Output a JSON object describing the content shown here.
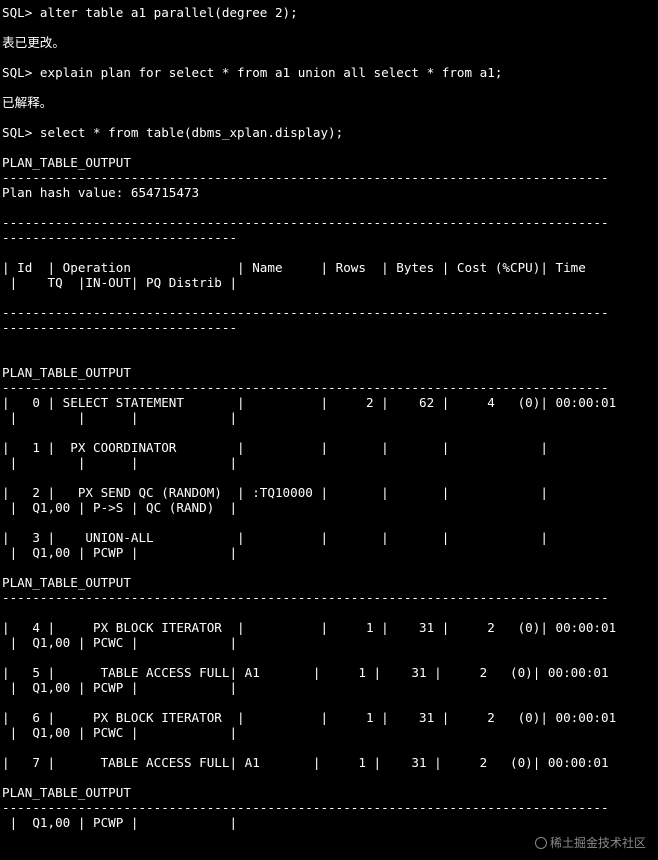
{
  "terminal": {
    "lines": [
      "SQL> alter table a1 parallel(degree 2);",
      "",
      "表已更改。",
      "",
      "SQL> explain plan for select * from a1 union all select * from a1;",
      "",
      "已解释。",
      "",
      "SQL> select * from table(dbms_xplan.display);",
      "",
      "PLAN_TABLE_OUTPUT",
      "--------------------------------------------------------------------------------",
      "Plan hash value: 654715473",
      "",
      "--------------------------------------------------------------------------------",
      "-------------------------------",
      "",
      "| Id  | Operation              | Name     | Rows  | Bytes | Cost (%CPU)| Time",
      " |    TQ  |IN-OUT| PQ Distrib |",
      "",
      "--------------------------------------------------------------------------------",
      "-------------------------------",
      "",
      "",
      "PLAN_TABLE_OUTPUT",
      "--------------------------------------------------------------------------------",
      "|   0 | SELECT STATEMENT       |          |     2 |    62 |     4   (0)| 00:00:01",
      " |        |      |            |",
      "",
      "|   1 |  PX COORDINATOR        |          |       |       |            |",
      " |        |      |            |",
      "",
      "|   2 |   PX SEND QC (RANDOM)  | :TQ10000 |       |       |            |",
      " |  Q1,00 | P->S | QC (RAND)  |",
      "",
      "|   3 |    UNION-ALL           |          |       |       |            |",
      " |  Q1,00 | PCWP |            |",
      "",
      "PLAN_TABLE_OUTPUT",
      "--------------------------------------------------------------------------------",
      "",
      "|   4 |     PX BLOCK ITERATOR  |          |     1 |    31 |     2   (0)| 00:00:01",
      " |  Q1,00 | PCWC |            |",
      "",
      "|   5 |      TABLE ACCESS FULL| A1       |     1 |    31 |     2   (0)| 00:00:01",
      " |  Q1,00 | PCWP |            |",
      "",
      "|   6 |     PX BLOCK ITERATOR  |          |     1 |    31 |     2   (0)| 00:00:01",
      " |  Q1,00 | PCWC |            |",
      "",
      "|   7 |      TABLE ACCESS FULL| A1       |     1 |    31 |     2   (0)| 00:00:01",
      "",
      "PLAN_TABLE_OUTPUT",
      "--------------------------------------------------------------------------------",
      " |  Q1,00 | PCWP |            |",
      "",
      "",
      "--------------------------------------------------------------------------------"
    ]
  },
  "watermark": {
    "text": "稀土掘金技术社区",
    "icon": "logo-icon"
  },
  "colors": {
    "background": "#000000",
    "text": "#ffffff",
    "watermark": "#8a8a8a"
  }
}
